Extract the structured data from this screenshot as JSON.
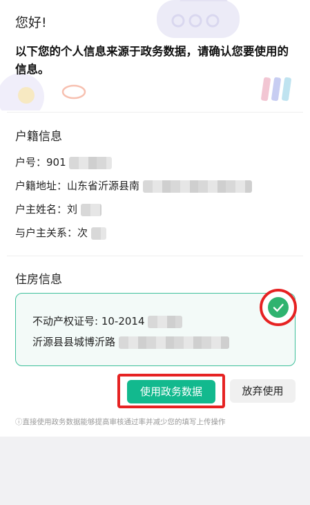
{
  "header": {
    "greeting": "您好!",
    "intro": "以下您的个人信息来源于政务数据，请确认您要使用的信息。"
  },
  "household": {
    "title": "户籍信息",
    "fields": [
      {
        "label": "户号：",
        "value": "901"
      },
      {
        "label": "户籍地址：",
        "value": "山东省沂源县南"
      },
      {
        "label": "户主姓名：",
        "value": "刘"
      },
      {
        "label": "与户主关系：",
        "value": "次"
      }
    ]
  },
  "housing": {
    "title": "住房信息",
    "cert_label": "不动产权证号: ",
    "cert_value": "10-2014",
    "address": "沂源县县城博沂路",
    "selected": true
  },
  "actions": {
    "use_label": "使用政务数据",
    "abandon_label": "放弃使用"
  },
  "tip": "ⓘ直接使用政务数据能够提高审核通过率并减少您的填写上传操作",
  "colors": {
    "primary": "#12b98e",
    "highlight": "#e62222",
    "check": "#2fb36f"
  }
}
